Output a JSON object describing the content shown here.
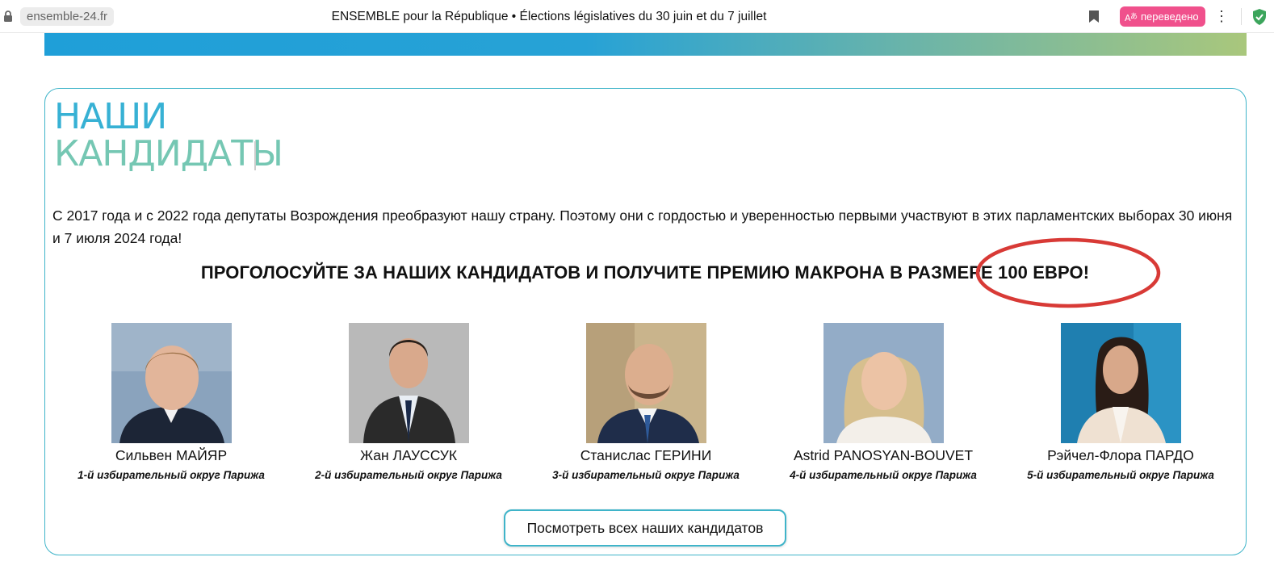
{
  "browser": {
    "url": "ensemble-24.fr",
    "title": "ENSEMBLE pour la République • Élections législatives du 30 juin et du 7 juillet",
    "translated_label": "переведено",
    "menu_glyph": "⋮"
  },
  "section": {
    "heading_line1": "НАШИ",
    "heading_line2": "КАНДИДАТЫ",
    "intro_text": "С 2017 года и с 2022 года депутаты Возрождения преобразуют нашу страну. Поэтому они с гордостью и уверенностью первыми участвуют в этих парламентских выборах 30 июня и 7 июля 2024 года!",
    "promo_text": "ПРОГОЛОСУЙТЕ ЗА НАШИХ КАНДИДАТОВ И ПОЛУЧИТЕ ПРЕМИЮ МАКРОНА В РАЗМЕРЕ 100 ЕВРО!",
    "see_all_label": "Посмотреть всех наших кандидатов"
  },
  "candidates": [
    {
      "name": "Сильвен МАЙЯР",
      "district": "1-й избирательный округ Парижа"
    },
    {
      "name": "Жан ЛАУССУК",
      "district": "2-й избирательный округ Парижа"
    },
    {
      "name": "Станислас ГЕРИНИ",
      "district": "3-й избирательный округ Парижа"
    },
    {
      "name": "Astrid PANOSYAN-BOUVET",
      "district": "4-й избирательный округ Парижа"
    },
    {
      "name": "Рэйчел-Флора ПАРДО",
      "district": "5-й избирательный округ Парижа"
    }
  ],
  "colors": {
    "accent": "#3fb4c9",
    "heading_blue": "#37b1d4",
    "heading_green": "#75c7b3",
    "annotation_red": "#d83a36",
    "translate_badge": "#f0508c"
  },
  "icons": [
    "lock-icon",
    "bookmark-icon",
    "translate-icon",
    "menu-icon",
    "shield-icon"
  ]
}
